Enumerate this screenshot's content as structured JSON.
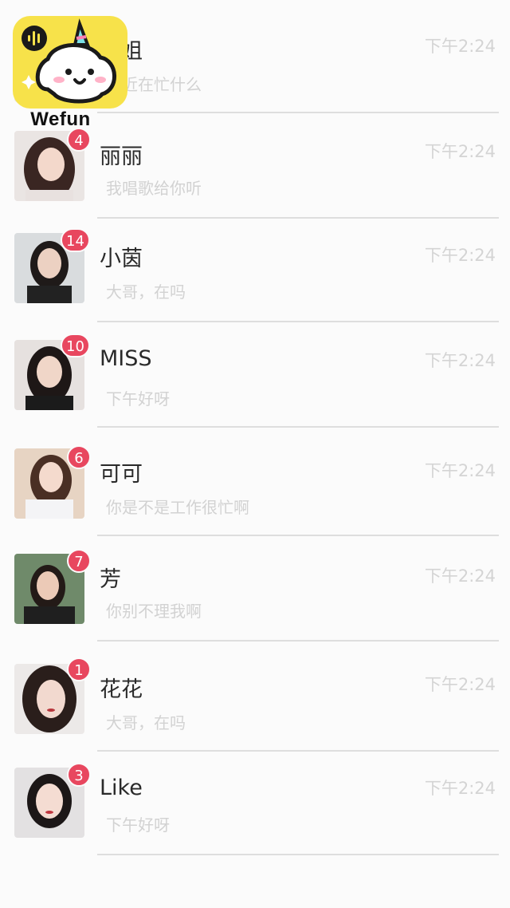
{
  "logo": {
    "wordmark": "Wefun",
    "icon": "wefun-logo-icon",
    "accent": "#f7e24a"
  },
  "colors": {
    "badge": "#e8475f",
    "name": "#2a2a2a",
    "muted": "#d2d2d2",
    "divider": "#dedede"
  },
  "chats": [
    {
      "name": "姐姐",
      "preview": "最近在忙什么",
      "time": "下午2:24",
      "unread": ""
    },
    {
      "name": "丽丽",
      "preview": "我唱歌给你听",
      "time": "下午2:24",
      "unread": "4"
    },
    {
      "name": "小茵",
      "preview": "大哥，在吗",
      "time": "下午2:24",
      "unread": "14"
    },
    {
      "name": "MISS",
      "preview": "下午好呀",
      "time": "下午2:24",
      "unread": "10"
    },
    {
      "name": "可可",
      "preview": "你是不是工作很忙啊",
      "time": "下午2:24",
      "unread": "6"
    },
    {
      "name": "芳",
      "preview": "你别不理我啊",
      "time": "下午2:24",
      "unread": "7"
    },
    {
      "name": "花花",
      "preview": "大哥，在吗",
      "time": "下午2:24",
      "unread": "1"
    },
    {
      "name": "Like",
      "preview": "下午好呀",
      "time": "下午2:24",
      "unread": "3"
    }
  ]
}
